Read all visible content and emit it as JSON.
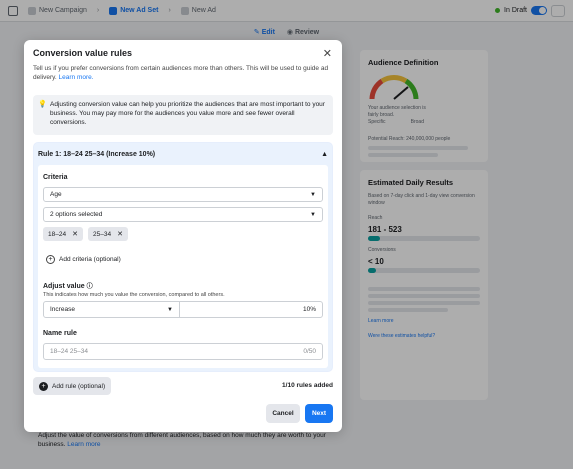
{
  "topbar": {
    "crumbs": [
      "New Campaign",
      "New Ad Set",
      "New Ad"
    ],
    "status": "In Draft"
  },
  "modebar": {
    "edit": "Edit",
    "review": "Review"
  },
  "right": {
    "audience_title": "Audience Definition",
    "audience_text": "Your audience selection is fairly broad.",
    "gauge_specific": "Specific",
    "gauge_broad": "Broad",
    "potential_reach": "Potential Reach: 240,000,000 people",
    "estimated_title": "Estimated Daily Results",
    "estimated_sub": "Based on 7-day click and 1-day view conversion window",
    "reach_label": "Reach",
    "reach_value": "181 - 523",
    "conv_label": "Conversions",
    "conv_value": "< 10",
    "learn_more": "Learn more",
    "estimates_link": "Were these estimates helpful?"
  },
  "background_text": "Adjust the value of conversions from different audiences, based on how much they are worth to your business.",
  "background_link": "Learn more",
  "modal": {
    "title": "Conversion value rules",
    "description": "Tell us if you prefer conversions from certain audiences more than others. This will be used to guide ad delivery.",
    "learn_more": "Learn more.",
    "info_text": "Adjusting conversion value can help you prioritize the audiences that are most important to your business. You may pay more for the audiences you value more and see fewer overall conversions.",
    "rule": {
      "header": "Rule 1: 18–24 25–34 (Increase 10%)",
      "criteria_label": "Criteria",
      "criteria_select": "Age",
      "options_select": "2 options selected",
      "chips": [
        "18–24",
        "25–34"
      ],
      "add_criteria": "Add criteria (optional)",
      "adjust_label": "Adjust value",
      "adjust_help": "This indicates how much you value the conversion, compared to all others.",
      "adjust_direction": "Increase",
      "adjust_amount": "10%",
      "name_label": "Name rule",
      "name_placeholder": "18–24 25–34",
      "name_count": "0/50"
    },
    "add_rule": "Add rule (optional)",
    "rules_added": "1/10 rules added",
    "cancel": "Cancel",
    "next": "Next"
  }
}
